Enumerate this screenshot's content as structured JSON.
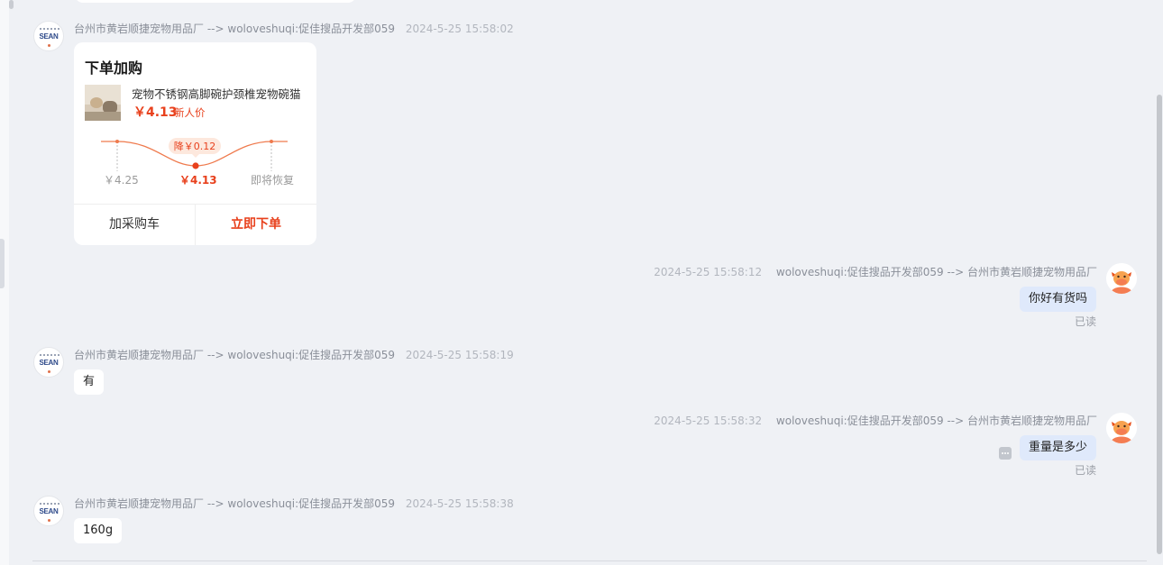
{
  "seller_name": "台州市黄岩顺捷宠物用品厂",
  "buyer_name": "woloveshuqi:促佳搜品开发部059",
  "arrow": "-->",
  "seller_logo_text": "SEAN",
  "read_status": "已读",
  "messages": [
    {
      "side": "left",
      "time": "2024-5-25 15:58:02",
      "type": "order_card"
    },
    {
      "side": "right",
      "time": "2024-5-25 15:58:12",
      "text": "你好有货吗"
    },
    {
      "side": "left",
      "time": "2024-5-25 15:58:19",
      "text": "有"
    },
    {
      "side": "right",
      "time": "2024-5-25 15:58:32",
      "text": "重量是多少"
    },
    {
      "side": "left",
      "time": "2024-5-25 15:58:38",
      "text": "160g"
    }
  ],
  "order_card": {
    "title": "下单加购",
    "product_name": "宠物不锈钢高脚碗护颈椎宠物碗猫",
    "price": "￥4.13",
    "price_tag": "新人价",
    "drop_badge": "降￥0.12",
    "price_before": "￥4.25",
    "price_now": "￥4.13",
    "price_after": "即将恢复",
    "add_cart_label": "加采购车",
    "order_now_label": "立即下单"
  },
  "colors": {
    "accent": "#e8401c",
    "right_bubble": "#dfe9fb",
    "background": "#eff1f5"
  }
}
